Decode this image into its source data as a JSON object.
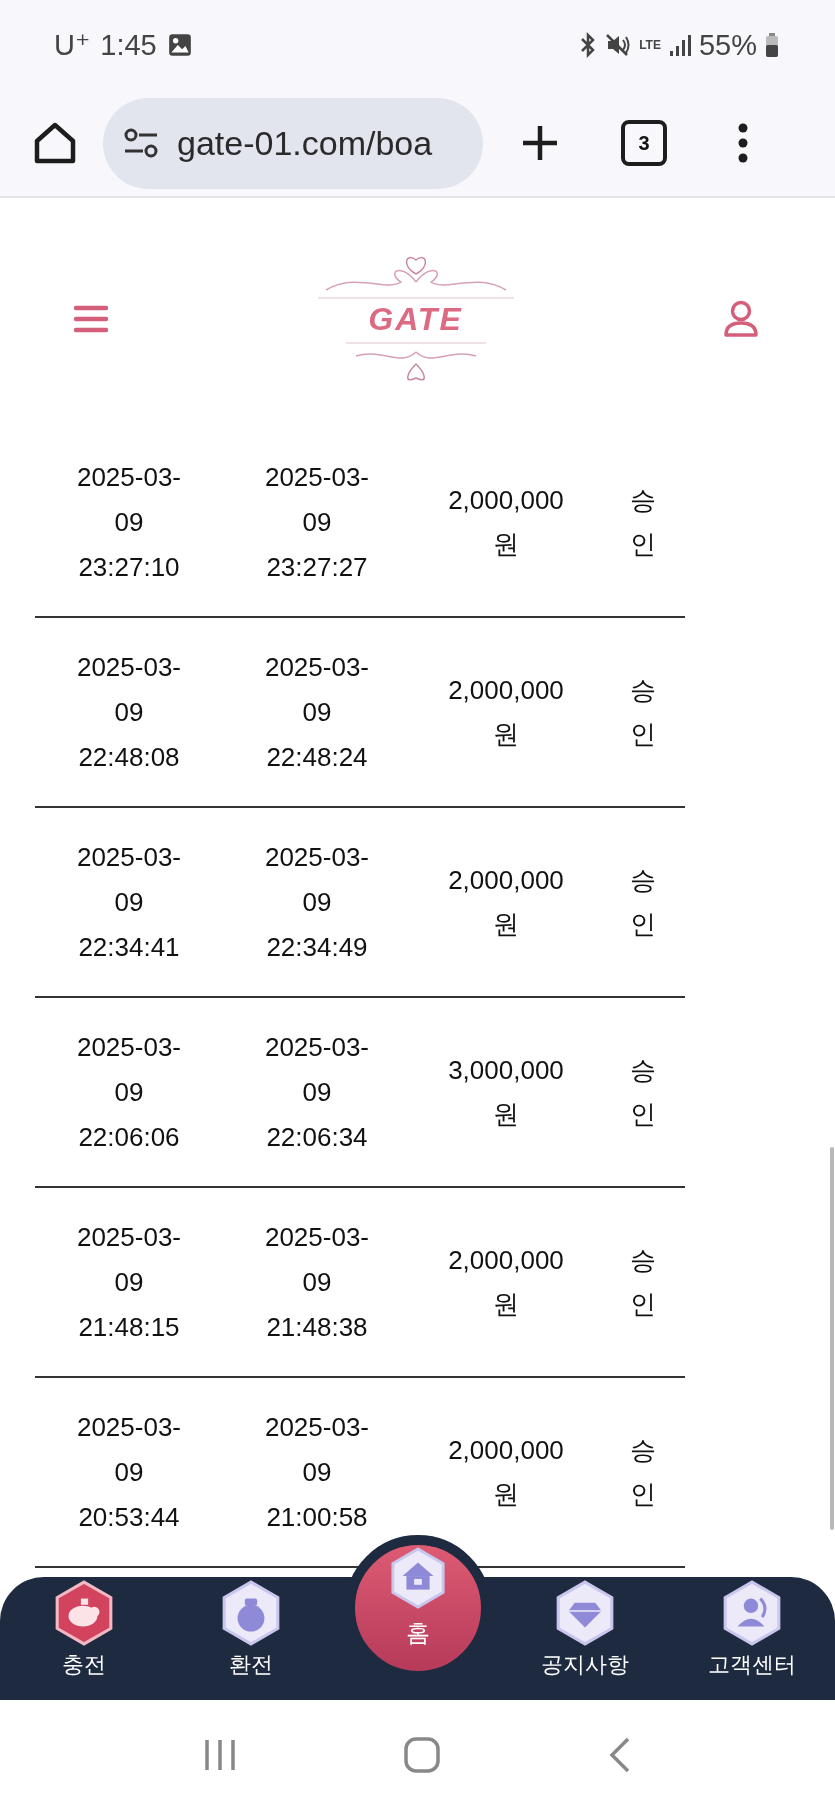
{
  "status_bar": {
    "carrier": "U⁺",
    "time": "1:45",
    "network": "LTE",
    "battery": "55%"
  },
  "browser": {
    "url": "gate-01.com/boa",
    "tab_count": "3"
  },
  "header": {
    "logo": "GATE"
  },
  "rows": [
    {
      "column_1": "2025-03-\n09\n23:27:10",
      "column_2": "2025-03-\n09\n23:27:27",
      "column_3": "2,000,000\n원",
      "column_4": "승\n인"
    },
    {
      "column_1": "2025-03-\n09\n22:48:08",
      "column_2": "2025-03-\n09\n22:48:24",
      "column_3": "2,000,000\n원",
      "column_4": "승\n인"
    },
    {
      "column_1": "2025-03-\n09\n22:34:41",
      "column_2": "2025-03-\n09\n22:34:49",
      "column_3": "2,000,000\n원",
      "column_4": "승\n인"
    },
    {
      "column_1": "2025-03-\n09\n22:06:06",
      "column_2": "2025-03-\n09\n22:06:34",
      "column_3": "3,000,000\n원",
      "column_4": "승\n인"
    },
    {
      "column_1": "2025-03-\n09\n21:48:15",
      "column_2": "2025-03-\n09\n21:48:38",
      "column_3": "2,000,000\n원",
      "column_4": "승\n인"
    },
    {
      "column_1": "2025-03-\n09\n20:53:44",
      "column_2": "2025-03-\n09\n21:00:58",
      "column_3": "2,000,000\n원",
      "column_4": "승\n인"
    }
  ],
  "bottom_nav": [
    {
      "label": "충전",
      "selected": false
    },
    {
      "label": "환전",
      "selected": false
    },
    {
      "label": "홈",
      "selected": true
    },
    {
      "label": "공지사항",
      "selected": false
    },
    {
      "label": "고객센터",
      "selected": false
    }
  ]
}
